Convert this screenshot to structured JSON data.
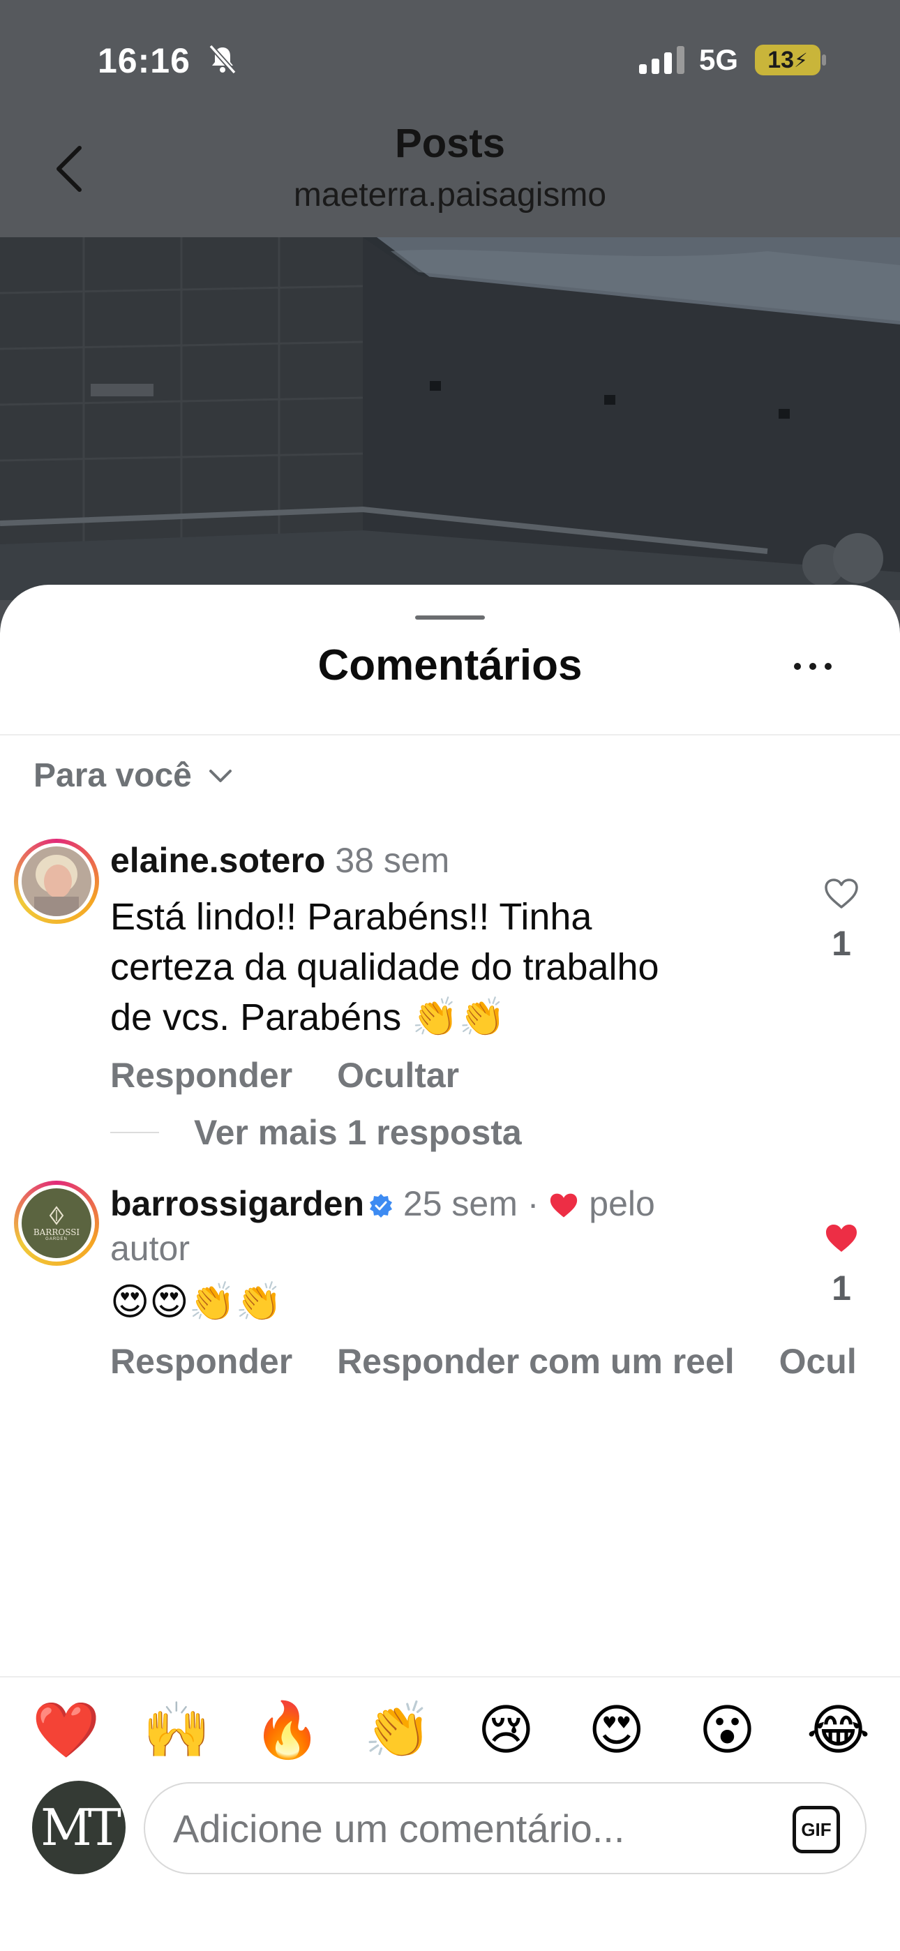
{
  "status_bar": {
    "time": "16:16",
    "network": "5G",
    "battery": "13",
    "icons": [
      "bell-off-icon",
      "signal-icon",
      "battery-charging-icon"
    ]
  },
  "header": {
    "title": "Posts",
    "subtitle": "maeterra.paisagismo",
    "back_icon": "chevron-left-icon"
  },
  "sheet": {
    "title": "Comentários",
    "more_icon": "ellipsis-icon",
    "filter_label": "Para você",
    "filter_icon": "chevron-down-icon"
  },
  "comments": [
    {
      "username": "elaine.sotero",
      "time": "38 sem",
      "text": "Está lindo!! Parabéns!! Tinha certeza da qualidade do trabalho de vcs. Parabéns 👏👏",
      "text_lines": [
        "Está lindo!! Parabéns!! Tinha",
        "certeza da qualidade do trabalho",
        "de vcs. Parabéns 👏👏"
      ],
      "likes": "1",
      "liked": false,
      "actions": [
        "Responder",
        "Ocultar"
      ],
      "more_replies": "Ver mais 1 resposta"
    },
    {
      "username": "barrossigarden",
      "verified": true,
      "time": "25 sem",
      "dot": "·",
      "liked_by_author_line1": "pelo",
      "liked_by_author_line2": "autor",
      "text": "😍😍👏👏",
      "likes": "1",
      "liked": true,
      "actions": [
        "Responder",
        "Responder com um reel",
        "Ocul"
      ],
      "avatar_brand": "BARROSSI",
      "avatar_brand_sub": "GARDEN"
    }
  ],
  "quick_reactions": [
    "❤️",
    "🙌",
    "🔥",
    "👏",
    "😢",
    "😍",
    "😮",
    "😂"
  ],
  "composer": {
    "avatar_initials": "MT",
    "placeholder": "Adicione um comentário...",
    "gif_label": "GIF"
  },
  "colors": {
    "like_red": "#ed2e45",
    "verified_blue": "#3d8bf2",
    "muted_text": "#74777b"
  }
}
